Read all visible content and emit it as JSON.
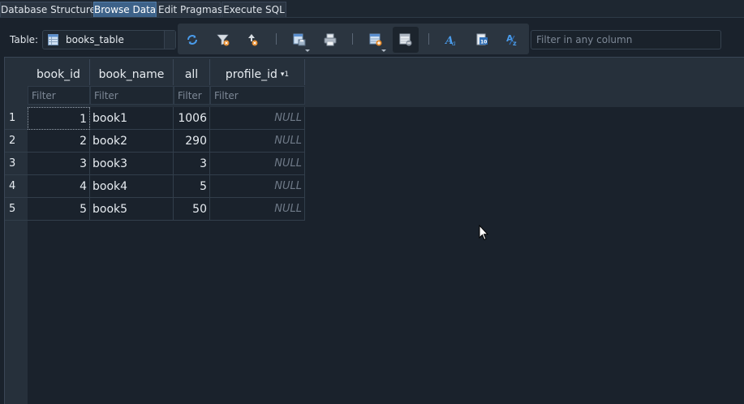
{
  "tabs": [
    "Database Structure",
    "Browse Data",
    "Edit Pragmas",
    "Execute SQL"
  ],
  "active_tab": 1,
  "table_label": "Table:",
  "table_name": "books_table",
  "filter_all_placeholder": "Filter in any column",
  "filter_placeholder": "Filter",
  "columns": [
    "book_id",
    "book_name",
    "all",
    "profile_id"
  ],
  "sort_indicator": "▾1",
  "rows": [
    {
      "num": "1",
      "book_id": "1",
      "book_name": "book1",
      "all": "1006",
      "profile_id": "NULL"
    },
    {
      "num": "2",
      "book_id": "2",
      "book_name": "book2",
      "all": "290",
      "profile_id": "NULL"
    },
    {
      "num": "3",
      "book_id": "3",
      "book_name": "book3",
      "all": "3",
      "profile_id": "NULL"
    },
    {
      "num": "4",
      "book_id": "4",
      "book_name": "book4",
      "all": "5",
      "profile_id": "NULL"
    },
    {
      "num": "5",
      "book_id": "5",
      "book_name": "book5",
      "all": "50",
      "profile_id": "NULL"
    }
  ],
  "toolbar_icons": [
    "refresh-icon",
    "clear-filters-icon",
    "clear-sort-icon",
    "save-table-icon",
    "print-icon",
    "insert-record-icon",
    "delete-record-icon",
    "font-icon",
    "set-encoding-icon",
    "text-format-icon"
  ],
  "colors": {
    "background": "#1a222c",
    "header": "#26303b",
    "active_tab": "#3d6289",
    "icon_blue": "#4a9bea",
    "icon_orange": "#e58a2a"
  }
}
